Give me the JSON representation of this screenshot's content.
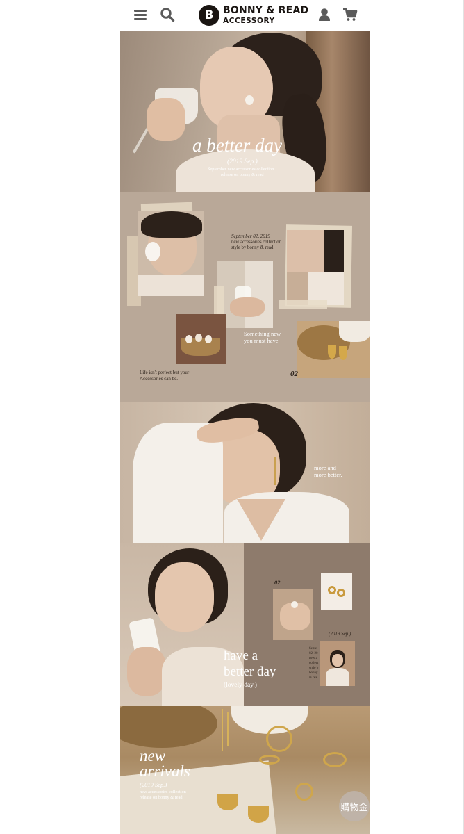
{
  "header": {
    "logo_mark": "B",
    "brand_line1": "BONNY & READ",
    "brand_line2": "ACCESSORY",
    "icons": [
      "menu-icon",
      "search-icon",
      "user-icon",
      "cart-icon"
    ]
  },
  "hero": {
    "title": "a better day",
    "date": "(2019 Sep.)",
    "line1": "September new accessories collection",
    "line2": "release on bonny & read"
  },
  "collage": {
    "date": "September 02, 2019",
    "line1": "new accessories collection",
    "line2": "style by bonny & read",
    "tagline1": "Something new",
    "tagline2": "you must have",
    "quote1": "Life isn't perfect but your",
    "quote2": "Accessories can be.",
    "number": "02"
  },
  "portrait": {
    "line1": "more and",
    "line2": "more better."
  },
  "feature": {
    "number": "02",
    "date": "(2019 Sep.)",
    "title1": "have a",
    "title2": "better day",
    "subtitle": "(lovely day.)",
    "small_lines": [
      "Septe",
      "02, 20",
      "new a",
      "collect",
      "style b",
      "bonny",
      "& rea"
    ]
  },
  "arrivals": {
    "title1": "new",
    "title2": "arrivals",
    "date": "(2019 Sep.)",
    "line1": "new accessories collection",
    "line2": "release on bonny & read"
  },
  "floating_button": {
    "label": "購物金"
  },
  "colors": {
    "header_bg": "#ffffff",
    "brand_dark": "#1a1512",
    "collage_bg": "#b9a898",
    "feature_bg": "#8e7b6c",
    "text_light": "#ffffff"
  }
}
